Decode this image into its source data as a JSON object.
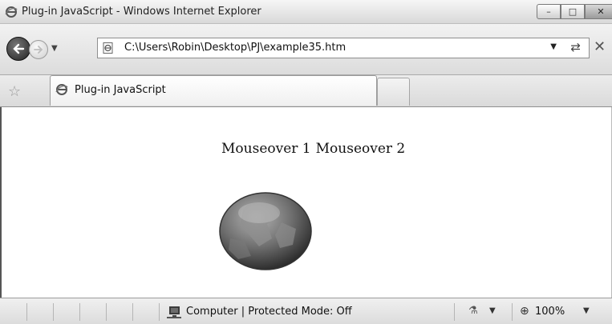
{
  "window": {
    "title": "Plug-in JavaScript - Windows Internet Explorer"
  },
  "address": {
    "url": "C:\\Users\\Robin\\Desktop\\PJ\\example35.htm"
  },
  "tabs": [
    {
      "label": "Plug-in JavaScript"
    }
  ],
  "content": {
    "links": [
      "Mouseover 1",
      "Mouseover 2"
    ]
  },
  "status": {
    "zone": "Computer | Protected Mode: Off",
    "zoom": "100%"
  },
  "icons": {
    "back": "back-arrow-icon",
    "forward": "forward-arrow-icon",
    "favorites": "favorites-star-icon",
    "page": "ie-page-icon",
    "refresh": "refresh-icon",
    "stop": "stop-icon",
    "zone": "computer-icon",
    "zoom": "zoom-icon"
  }
}
